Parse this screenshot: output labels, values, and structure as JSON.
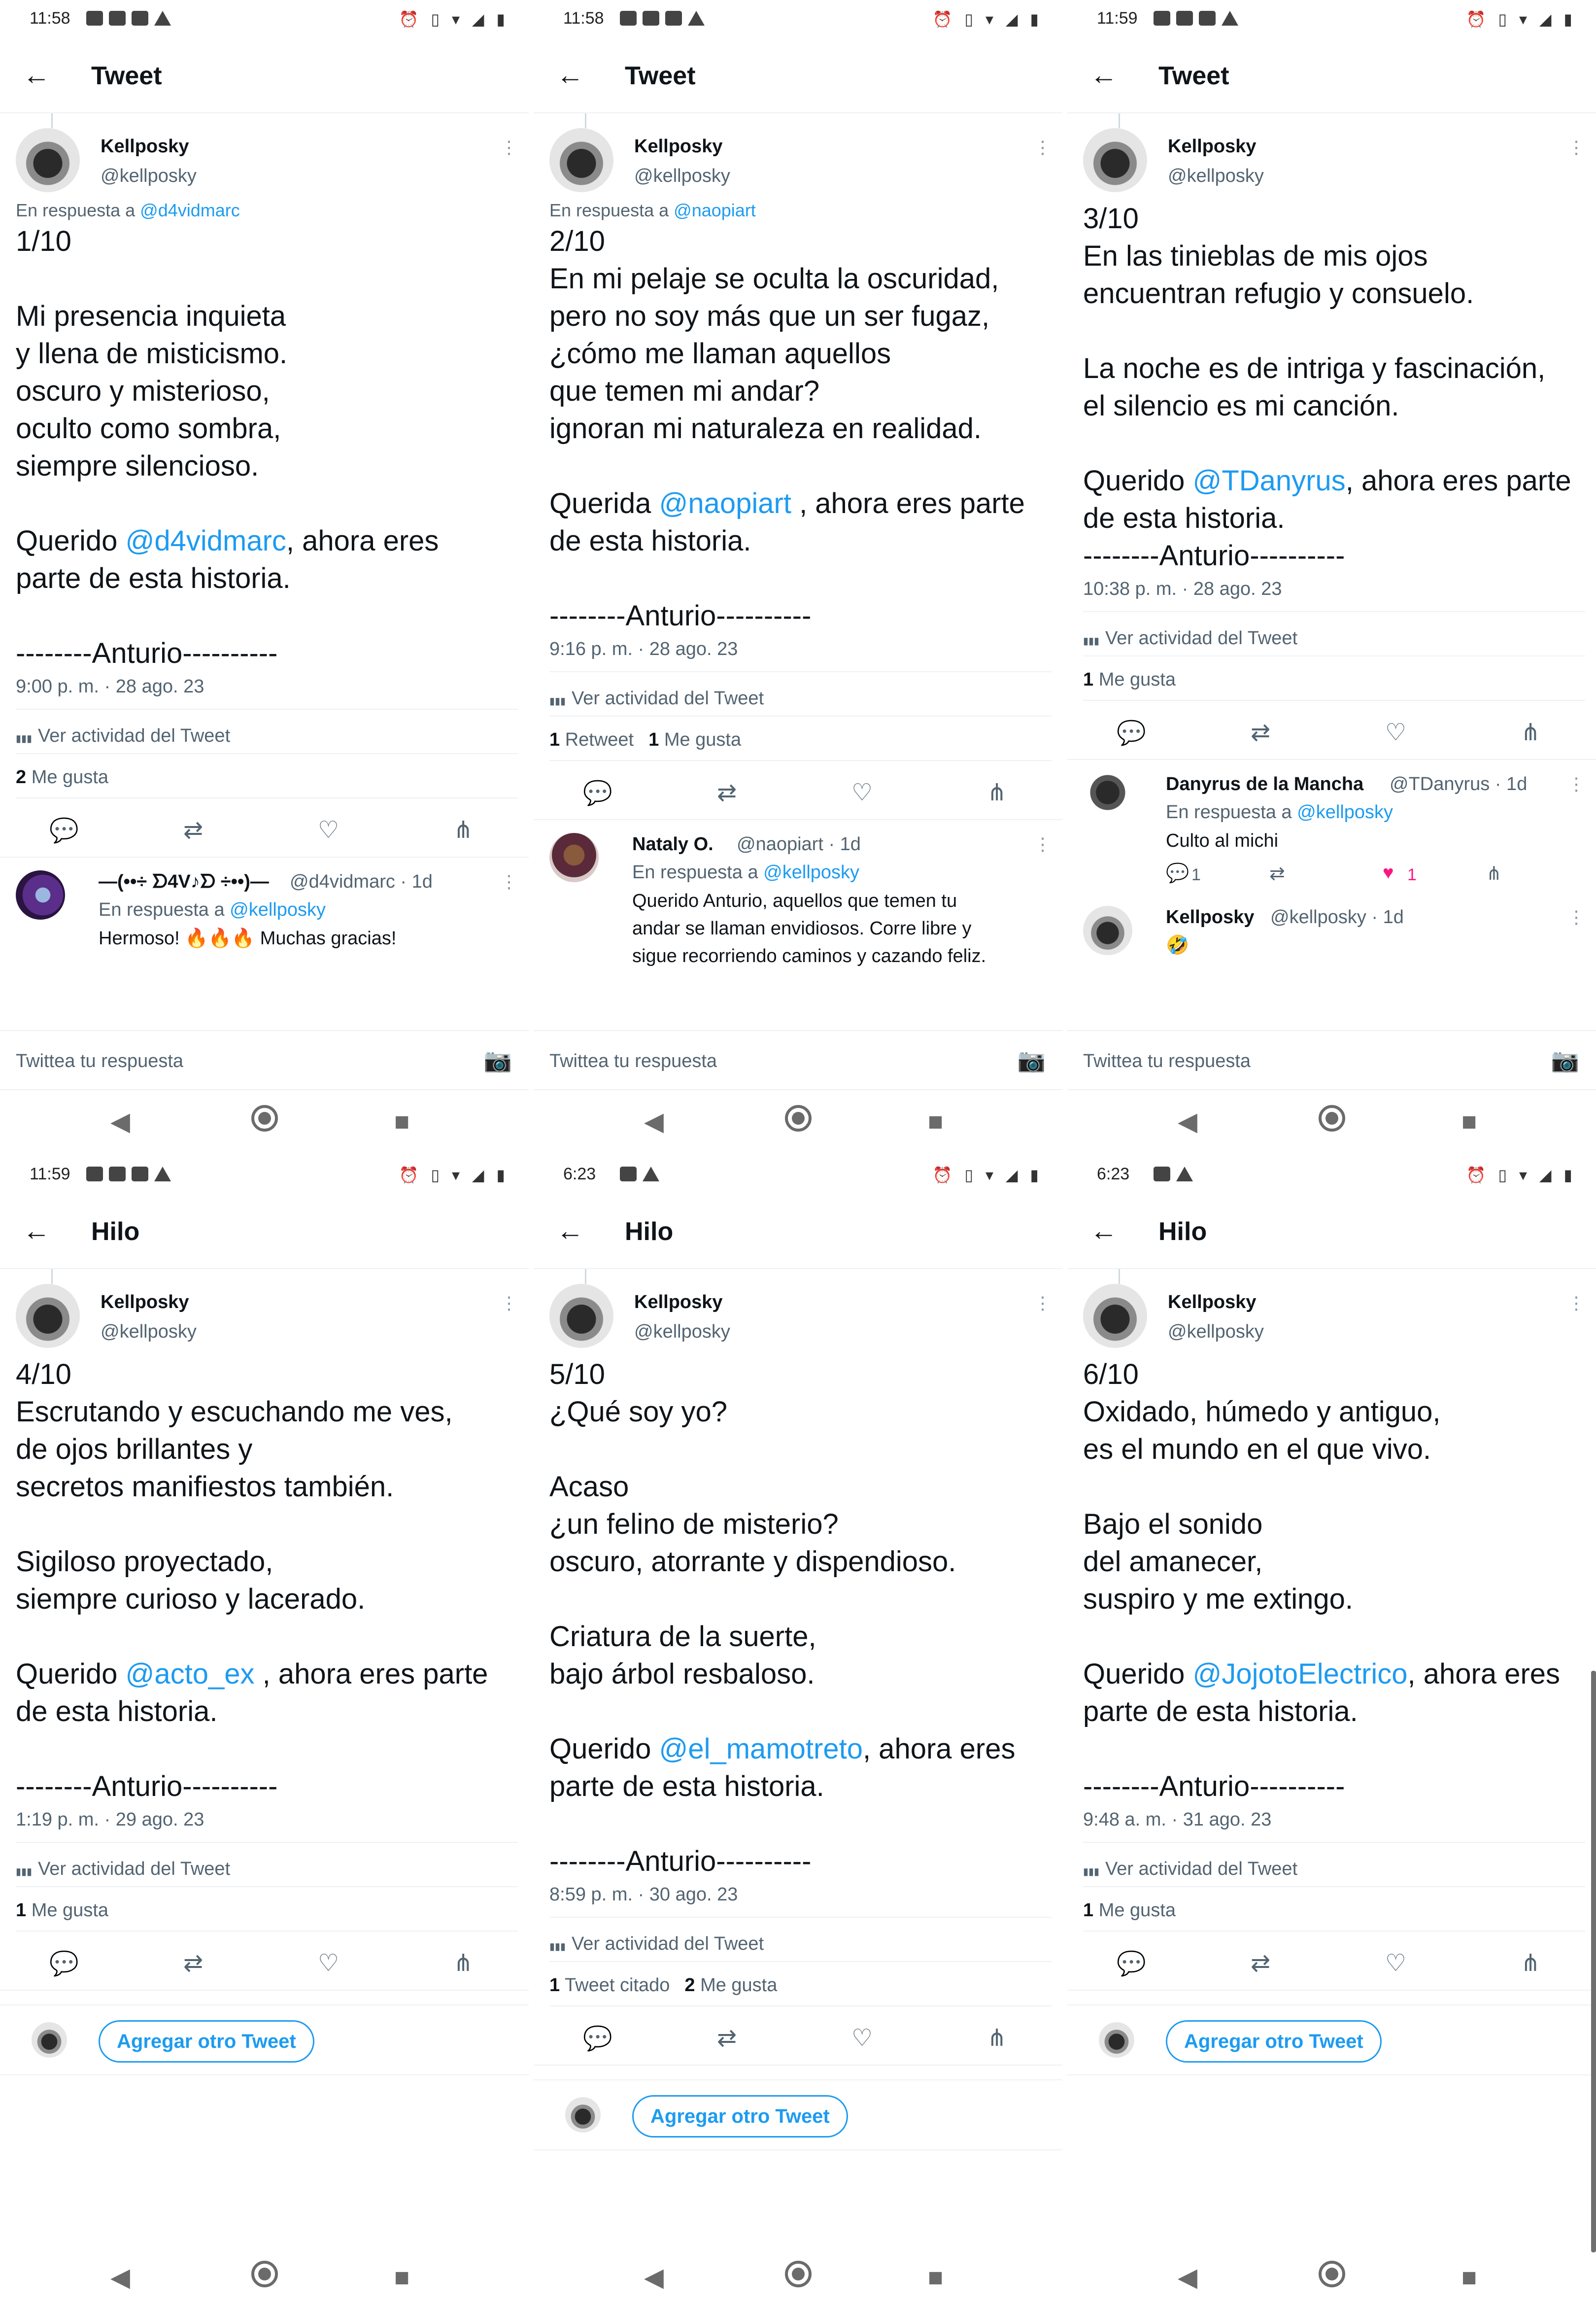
{
  "status_bar": {
    "times": [
      "11:58",
      "11:58",
      "11:59",
      "11:59",
      "6:23",
      "6:23"
    ],
    "right_icons": "⏰ ▯ ▾ ◢ ▮"
  },
  "header_titles": [
    "Tweet",
    "Tweet",
    "Tweet",
    "Hilo",
    "Hilo",
    "Hilo"
  ],
  "author": {
    "name": "Kellposky",
    "handle": "@kellposky"
  },
  "reply_label": "En respuesta a",
  "activity_label": "Ver actividad del Tweet",
  "compose_placeholder": "Twittea tu respuesta",
  "add_tweet_label": "Agregar otro Tweet",
  "icons": {
    "back": "back-arrow-icon",
    "reply": "reply-icon",
    "retweet": "retweet-icon",
    "like": "heart-icon",
    "share": "share-icon",
    "camera": "camera-icon",
    "more": "more-vertical-icon",
    "activity": "bar-chart-icon"
  },
  "accent_color": "#1d9bf0",
  "panels": [
    {
      "reply_to": "@d4vidmarc",
      "lines": [
        "1/10",
        "",
        "Mi presencia inquieta",
        "y llena de misticismo.",
        "oscuro y misterioso,",
        "oculto como sombra,",
        "siempre silencioso.",
        "",
        "Querido @d4vidmarc, ahora eres",
        "parte de esta historia.",
        "",
        "--------Anturio----------"
      ],
      "meta": "9:00 p. m. · 28 ago. 23",
      "stats": [
        {
          "n": "2",
          "label": "Me gusta"
        }
      ],
      "replies": [
        {
          "name": "—(••÷ ᗤ4V♪ᗤ ÷••)—",
          "handle": "@d4vidmarc · 1d",
          "reply_to": "@kellposky",
          "text": [
            "Hermoso! 🔥🔥🔥 Muchas gracias!"
          ]
        }
      ]
    },
    {
      "reply_to": "@naopiart",
      "lines": [
        "2/10",
        "En mi pelaje se oculta la oscuridad,",
        "pero no soy más que un ser fugaz,",
        "¿cómo me llaman aquellos",
        "que temen mi andar?",
        "ignoran mi naturaleza en realidad.",
        "",
        "Querida @naopiart , ahora eres parte",
        "de esta historia.",
        "",
        "--------Anturio----------"
      ],
      "meta": "9:16 p. m. · 28 ago. 23",
      "stats": [
        {
          "n": "1",
          "label": "Retweet"
        },
        {
          "n": "1",
          "label": "Me gusta"
        }
      ],
      "replies": [
        {
          "name": "Nataly O.",
          "handle": "@naopiart · 1d",
          "reply_to": "@kellposky",
          "text": [
            "Querido Anturio, aquellos que temen tu",
            "andar se llaman envidiosos. Corre libre y",
            "sigue recorriendo caminos y cazando feliz."
          ]
        }
      ]
    },
    {
      "reply_to": "",
      "lines": [
        "3/10",
        "En las tinieblas de mis ojos",
        "encuentran refugio y consuelo.",
        "",
        "La noche es de intriga y fascinación,",
        "el silencio es mi canción.",
        "",
        "Querido @TDanyrus, ahora eres parte",
        "de esta historia.",
        "--------Anturio----------"
      ],
      "meta": "10:38 p. m. · 28 ago. 23",
      "stats": [
        {
          "n": "1",
          "label": "Me gusta"
        }
      ],
      "replies": [
        {
          "name": "Danyrus de la Mancha",
          "handle": "@TDanyrus · 1d",
          "reply_to": "@kellposky",
          "text": [
            "Culto al michi"
          ],
          "counts": {
            "reply": "1",
            "like": "1"
          }
        },
        {
          "name": "Kellposky",
          "handle": "@kellposky · 1d",
          "reply_to": "",
          "text": [
            "🤣"
          ]
        }
      ]
    },
    {
      "reply_to": "",
      "lines": [
        "4/10",
        "Escrutando y escuchando me ves,",
        "de ojos brillantes y",
        "secretos manifiestos también.",
        "",
        "Sigiloso proyectado,",
        "siempre curioso y lacerado.",
        "",
        "Querido @acto_ex , ahora eres parte",
        "de esta historia.",
        "",
        "--------Anturio----------"
      ],
      "meta": "1:19 p. m. · 29 ago. 23",
      "stats": [
        {
          "n": "1",
          "label": "Me gusta"
        }
      ],
      "replies": []
    },
    {
      "reply_to": "",
      "lines": [
        "5/10",
        "¿Qué soy yo?",
        "",
        "Acaso",
        "¿un felino de misterio?",
        "oscuro, atorrante y dispendioso.",
        "",
        "Criatura de la suerte,",
        "bajo árbol resbaloso.",
        "",
        "Querido @el_mamotreto, ahora eres",
        "parte de esta historia.",
        "",
        "--------Anturio----------"
      ],
      "meta": "8:59 p. m. · 30 ago. 23",
      "stats": [
        {
          "n": "1",
          "label": "Tweet citado"
        },
        {
          "n": "2",
          "label": "Me gusta"
        }
      ],
      "replies": []
    },
    {
      "reply_to": "",
      "lines": [
        "6/10",
        "Oxidado, húmedo y antiguo,",
        "es el mundo en el que vivo.",
        "",
        "Bajo el sonido",
        "del amanecer,",
        "suspiro y me extingo.",
        "",
        "Querido @JojotoElectrico, ahora eres",
        "parte de esta historia.",
        "",
        "--------Anturio----------"
      ],
      "meta": "9:48 a. m. · 31 ago. 23",
      "stats": [
        {
          "n": "1",
          "label": "Me gusta"
        }
      ],
      "replies": []
    }
  ]
}
